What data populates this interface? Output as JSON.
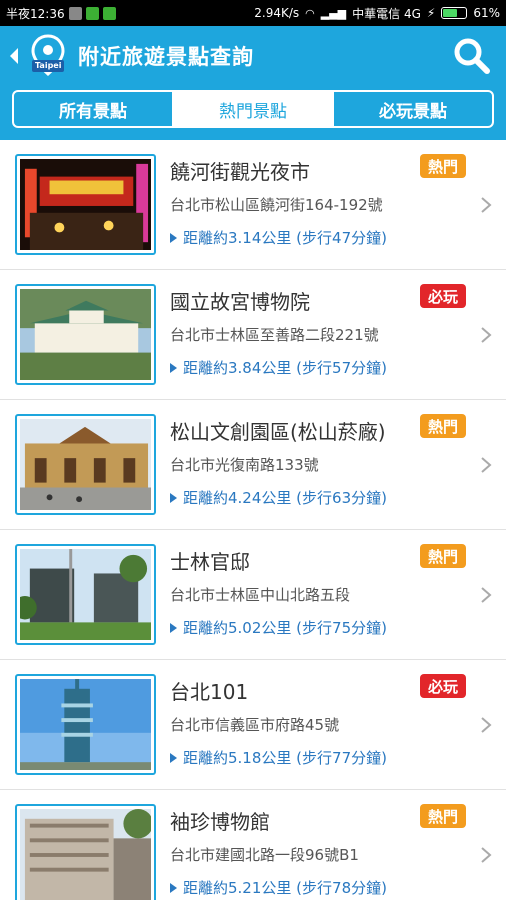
{
  "statusbar": {
    "time": "半夜12:36",
    "speed": "2.94K/s",
    "carrier": "中華電信 4G",
    "battery": "61%",
    "battery_level": 0.61
  },
  "appbar": {
    "logo_text": "Taipei",
    "title": "附近旅遊景點查詢"
  },
  "tabs": [
    {
      "label": "所有景點"
    },
    {
      "label": "熱門景點"
    },
    {
      "label": "必玩景點"
    }
  ],
  "active_tab": 1,
  "items": [
    {
      "name": "饒河街觀光夜市",
      "address": "台北市松山區饒河街164-192號",
      "distance": "距離約3.14公里 (步行47分鐘)",
      "badge": "熱門",
      "badge_type": "hot",
      "image": "night-market"
    },
    {
      "name": "國立故宮博物院",
      "address": "台北市士林區至善路二段221號",
      "distance": "距離約3.84公里 (步行57分鐘)",
      "badge": "必玩",
      "badge_type": "must",
      "image": "palace-museum"
    },
    {
      "name": "松山文創園區(松山菸廠)",
      "address": "台北市光復南路133號",
      "distance": "距離約4.24公里 (步行63分鐘)",
      "badge": "熱門",
      "badge_type": "hot",
      "image": "creative-park"
    },
    {
      "name": "士林官邸",
      "address": "台北市士林區中山北路五段",
      "distance": "距離約5.02公里 (步行75分鐘)",
      "badge": "熱門",
      "badge_type": "hot",
      "image": "residence"
    },
    {
      "name": "台北101",
      "address": "台北市信義區市府路45號",
      "distance": "距離約5.18公里 (步行77分鐘)",
      "badge": "必玩",
      "badge_type": "must",
      "image": "taipei-101"
    },
    {
      "name": "袖珍博物館",
      "address": "台北市建國北路一段96號B1",
      "distance": "距離約5.21公里 (步行78分鐘)",
      "badge": "熱門",
      "badge_type": "hot",
      "image": "miniature-museum"
    }
  ],
  "colors": {
    "primary": "#1ea6dd",
    "hot_badge": "#f39c1e",
    "must_badge": "#e2262a",
    "distance": "#2a78c0"
  }
}
